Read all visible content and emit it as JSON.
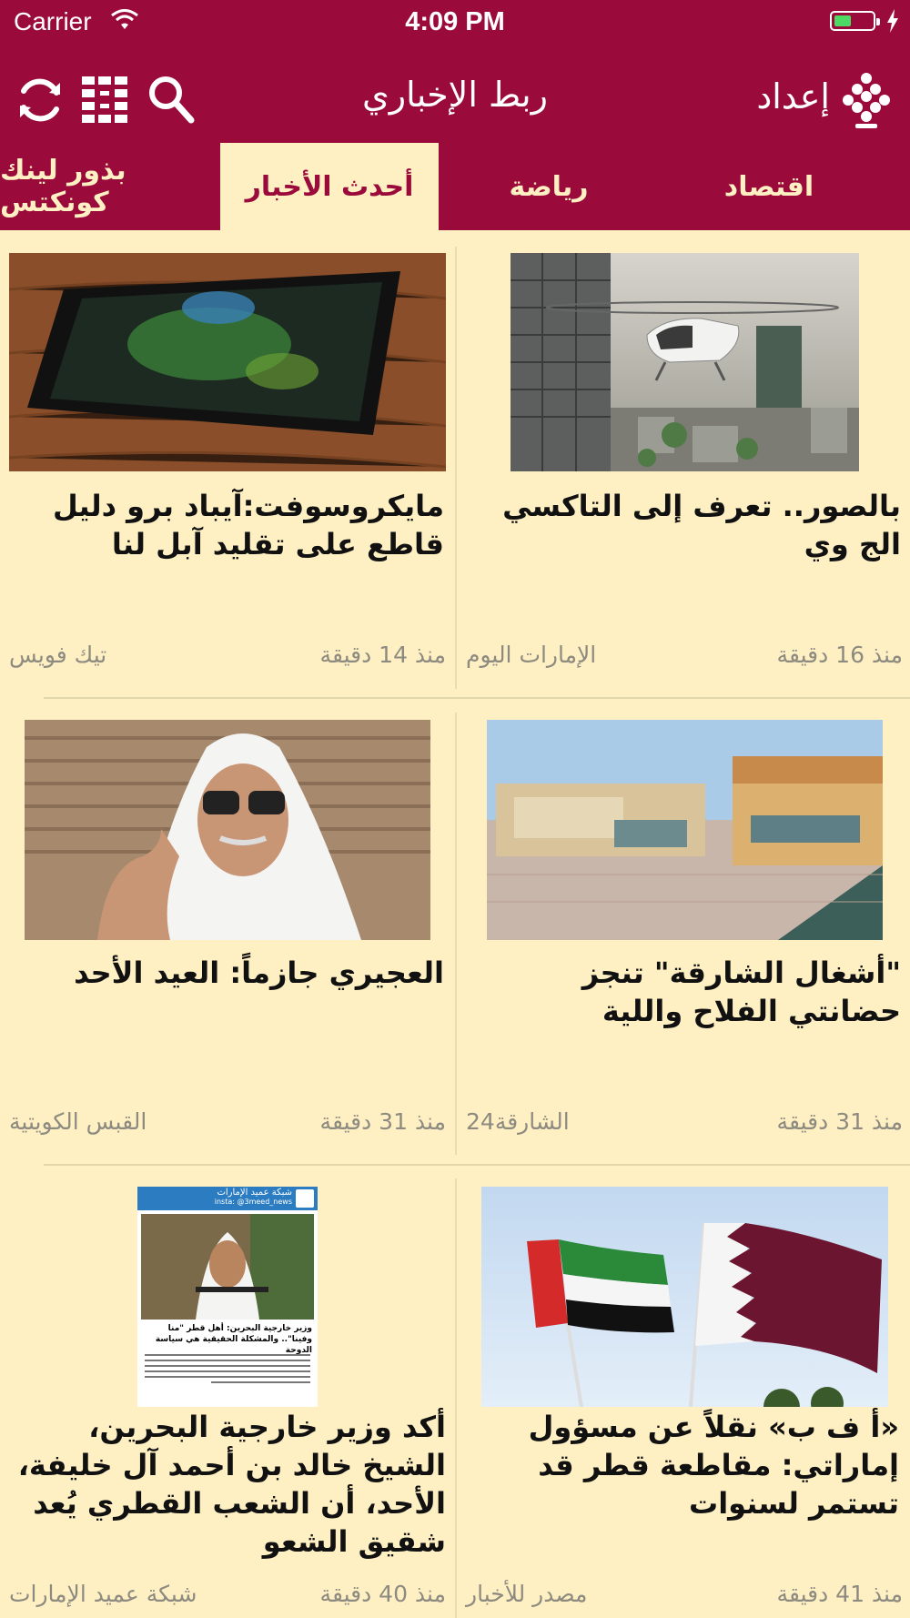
{
  "status_bar": {
    "carrier": "Carrier",
    "time": "4:09 PM"
  },
  "nav": {
    "title": "ربط الإخباري",
    "settings_label": "إعداد"
  },
  "tabs": [
    {
      "label": "اقتصاد",
      "active": false
    },
    {
      "label": "رياضة",
      "active": false
    },
    {
      "label": "أحدث الأخبار",
      "active": true
    },
    {
      "label": "بذور لينك كونكتس",
      "active": false
    }
  ],
  "articles": [
    {
      "headline": "بالصور.. تعرف إلى التاكسي الج وي",
      "time": "منذ 16 دقيقة",
      "source": "الإمارات اليوم",
      "image": "flying-taxi-photo"
    },
    {
      "headline": "مايكروسوفت:آيباد برو دليل قاطع على تقليد آبل لنا",
      "time": "منذ 14 دقيقة",
      "source": "تيك فويس",
      "image": "tablet-photo"
    },
    {
      "headline": "\"أشغال الشارقة\" تنجز حضانتي الفلاح واللية",
      "time": "منذ 31 دقيقة",
      "source": "الشارقة24",
      "image": "building-photo"
    },
    {
      "headline": "العجيري جازماً: العيد الأحد",
      "time": "منذ 31 دقيقة",
      "source": "القبس الكويتية",
      "image": "man-portrait-photo"
    },
    {
      "headline": "«أ ف ب» نقلاً عن مسؤول إماراتي: مقاطعة قطر قد تستمر لسنوات",
      "time": "منذ 41 دقيقة",
      "source": "مصدر للأخبار",
      "image": "flags-photo"
    },
    {
      "headline": "أكد وزير خارجية البحرين، الشيخ خالد بن أحمد آل خليفة، الأحد، أن الشعب القطري يُعد شقيق الشعو",
      "time": "منذ 40 دقيقة",
      "source": "شبكة عميد الإمارات",
      "image": "news-clipping-photo"
    }
  ],
  "clipping": {
    "brand": "شبكة عميد الإمارات",
    "handle": "insta: @3meed_news",
    "title": "وزير خارجية البحرين: أهل قطر \"منا وفينا\".. والمشكلة الحقيقية هي سياسة الدوحة"
  },
  "colors": {
    "brand": "#9a0a3b",
    "background": "#fff0c4",
    "meta_text": "#8d8a80"
  }
}
